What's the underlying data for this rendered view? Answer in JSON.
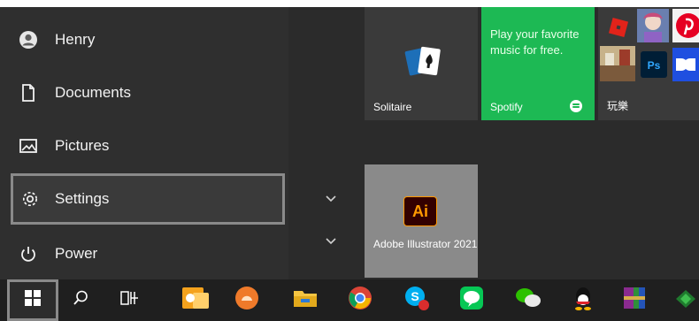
{
  "left_rail": {
    "items": [
      {
        "label": "Henry",
        "icon": "user-avatar-icon"
      },
      {
        "label": "Documents",
        "icon": "document-icon"
      },
      {
        "label": "Pictures",
        "icon": "pictures-icon"
      },
      {
        "label": "Settings",
        "icon": "gear-icon"
      },
      {
        "label": "Power",
        "icon": "power-icon"
      }
    ]
  },
  "tiles": {
    "solitaire": {
      "label": "Solitaire"
    },
    "spotify": {
      "label": "Spotify",
      "promo": "Play your favorite music for free."
    },
    "play": {
      "label": "玩樂"
    },
    "illustrator": {
      "label": "Adobe Illustrator 2021",
      "badge": "Ai"
    }
  },
  "taskbar": {
    "items": [
      "start-button",
      "search-icon",
      "task-view-icon",
      "outlook-icon",
      "app-orange-icon",
      "file-explorer-icon",
      "chrome-icon",
      "skype-icon",
      "line-icon",
      "wechat-icon",
      "qq-icon",
      "winrar-icon",
      "app-green-icon"
    ]
  },
  "colors": {
    "spotify_green": "#1db954",
    "illustrator_orange": "#ff9a00",
    "panel": "#2b2b2b",
    "taskbar": "#1f1f1f"
  }
}
